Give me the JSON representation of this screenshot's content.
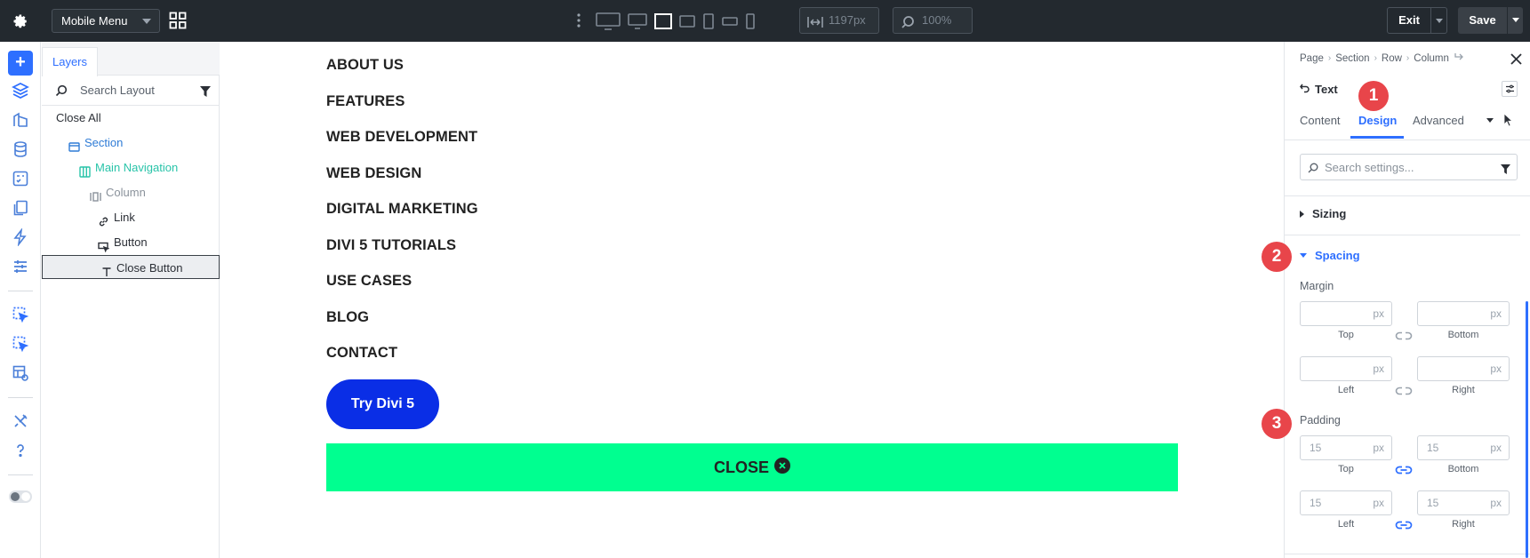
{
  "topbar": {
    "page_select": "Mobile Menu",
    "width_value": "1197px",
    "zoom_value": "100%",
    "exit_label": "Exit",
    "save_label": "Save"
  },
  "layers": {
    "tab_label": "Layers",
    "search_placeholder": "Search Layout",
    "close_all": "Close All",
    "items": [
      {
        "label": "Section",
        "color": "#2e7bd6"
      },
      {
        "label": "Main Navigation",
        "color": "#29c4a9"
      },
      {
        "label": "Column",
        "color": "#8a929b"
      },
      {
        "label": "Link",
        "color": "#2b2f36"
      },
      {
        "label": "Button",
        "color": "#2b2f36"
      },
      {
        "label": "Close Button",
        "color": "#2b2f36"
      }
    ]
  },
  "canvas": {
    "nav_links": [
      "ABOUT US",
      "FEATURES",
      "WEB DEVELOPMENT",
      "WEB DESIGN",
      "DIGITAL MARKETING",
      "DIVI 5 TUTORIALS",
      "USE CASES",
      "BLOG",
      "CONTACT"
    ],
    "cta_label": "Try Divi 5",
    "close_label": "CLOSE",
    "close_bar_color": "#00ff90",
    "cta_color": "#0a2ee6"
  },
  "panel": {
    "breadcrumbs": [
      "Page",
      "Section",
      "Row",
      "Column"
    ],
    "module_title": "Text",
    "tabs": [
      "Content",
      "Design",
      "Advanced"
    ],
    "active_tab": "Design",
    "search_placeholder": "Search settings...",
    "groups": {
      "sizing": "Sizing",
      "spacing": "Spacing"
    },
    "margin": {
      "label": "Margin",
      "unit": "px",
      "top": {
        "caption": "Top",
        "value": ""
      },
      "bottom": {
        "caption": "Bottom",
        "value": ""
      },
      "left": {
        "caption": "Left",
        "value": ""
      },
      "right": {
        "caption": "Right",
        "value": ""
      }
    },
    "padding": {
      "label": "Padding",
      "unit": "px",
      "top": {
        "caption": "Top",
        "value": "15"
      },
      "bottom": {
        "caption": "Bottom",
        "value": "15"
      },
      "left": {
        "caption": "Left",
        "value": "15"
      },
      "right": {
        "caption": "Right",
        "value": "15"
      }
    }
  },
  "badges": [
    "1",
    "2",
    "3"
  ],
  "accent_color": "#2e6fff",
  "badge_color": "#e8454a"
}
